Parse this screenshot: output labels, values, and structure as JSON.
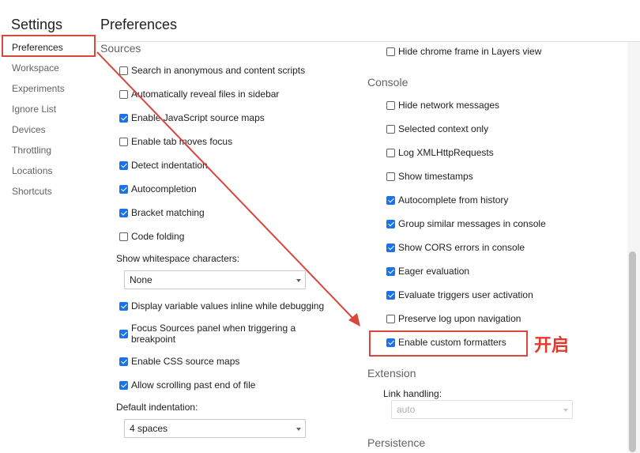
{
  "header": {
    "settings_title": "Settings",
    "page_title": "Preferences"
  },
  "sidebar": {
    "items": [
      {
        "label": "Preferences",
        "active": true
      },
      {
        "label": "Workspace"
      },
      {
        "label": "Experiments"
      },
      {
        "label": "Ignore List"
      },
      {
        "label": "Devices"
      },
      {
        "label": "Throttling"
      },
      {
        "label": "Locations"
      },
      {
        "label": "Shortcuts"
      }
    ]
  },
  "sources": {
    "title": "Sources",
    "opts": [
      {
        "label": "Search in anonymous and content scripts",
        "checked": false
      },
      {
        "label": "Automatically reveal files in sidebar",
        "checked": false
      },
      {
        "label": "Enable JavaScript source maps",
        "checked": true
      },
      {
        "label": "Enable tab moves focus",
        "checked": false
      },
      {
        "label": "Detect indentation",
        "checked": true
      },
      {
        "label": "Autocompletion",
        "checked": true
      },
      {
        "label": "Bracket matching",
        "checked": true
      },
      {
        "label": "Code folding",
        "checked": false
      }
    ],
    "whitespace_label": "Show whitespace characters:",
    "whitespace_value": "None",
    "opts2": [
      {
        "label": "Display variable values inline while debugging",
        "checked": true
      },
      {
        "label": "Focus Sources panel when triggering a breakpoint",
        "checked": true
      },
      {
        "label": "Enable CSS source maps",
        "checked": true
      },
      {
        "label": "Allow scrolling past end of file",
        "checked": true
      }
    ],
    "indent_label": "Default indentation:",
    "indent_value": "4 spaces"
  },
  "right": {
    "chrome_frame": {
      "label": "Hide chrome frame in Layers view",
      "checked": false
    },
    "console_title": "Console",
    "console": [
      {
        "label": "Hide network messages",
        "checked": false
      },
      {
        "label": "Selected context only",
        "checked": false
      },
      {
        "label": "Log XMLHttpRequests",
        "checked": false
      },
      {
        "label": "Show timestamps",
        "checked": false
      },
      {
        "label": "Autocomplete from history",
        "checked": true
      },
      {
        "label": "Group similar messages in console",
        "checked": true
      },
      {
        "label": "Show CORS errors in console",
        "checked": true
      },
      {
        "label": "Eager evaluation",
        "checked": true
      },
      {
        "label": "Evaluate triggers user activation",
        "checked": true
      },
      {
        "label": "Preserve log upon navigation",
        "checked": false
      },
      {
        "label": "Enable custom formatters",
        "checked": true
      }
    ],
    "extension_title": "Extension",
    "link_handling_label": "Link handling:",
    "link_handling_value": "auto",
    "persistence_title": "Persistence"
  },
  "annotation": {
    "text": "开启",
    "color": "#e8372b"
  },
  "colors": {
    "accent": "#1a73e8",
    "highlight": "#d9463b"
  }
}
